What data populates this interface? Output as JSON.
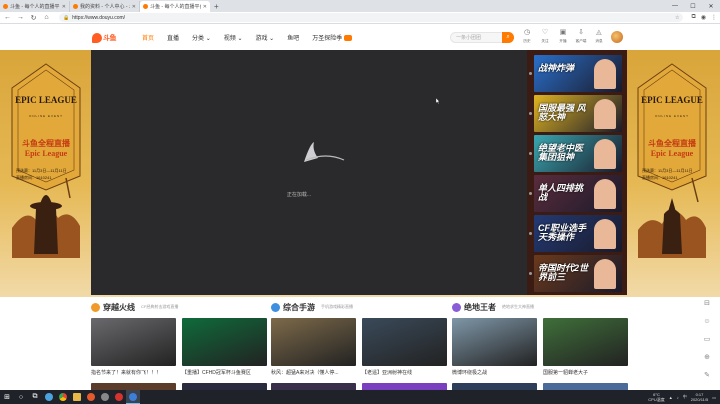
{
  "browser": {
    "tabs": [
      {
        "title": "斗鱼 - 每个人的直播平台",
        "active": false
      },
      {
        "title": "我的资料 - 个人中心 - 斗鱼",
        "active": false
      },
      {
        "title": "斗鱼 - 每个人的直播平台",
        "active": true
      }
    ],
    "new_tab": "+",
    "window_controls": [
      "—",
      "☐",
      "✕"
    ],
    "url": "https://www.douyu.com/",
    "back": "←",
    "forward": "→",
    "reload": "↻",
    "home": "⌂"
  },
  "header": {
    "logo_text": "斗鱼",
    "nav": [
      "首页",
      "直播",
      "分类",
      "视频",
      "游戏",
      "鱼吧",
      "万圣探险季"
    ],
    "nav_active_index": 0,
    "search_placeholder": "一条小团团",
    "search_button_icon": "search-icon",
    "user_menu": [
      {
        "label": "历史",
        "icon": "clock-icon"
      },
      {
        "label": "关注",
        "icon": "heart-icon"
      },
      {
        "label": "开播",
        "icon": "camera-icon"
      },
      {
        "label": "客户端",
        "icon": "download-icon"
      },
      {
        "label": "消息",
        "icon": "bell-icon"
      }
    ],
    "accent_color": "#ff7a00"
  },
  "banner": {
    "title_line1": "EPIC LEAGUE",
    "subtitle": "ONLINE EVENT",
    "cn_title": "斗鱼全程直播",
    "en_title": "Epic League",
    "date_line": "预选赛：11月3日—11月11日",
    "room_line": "直播房间：1610241"
  },
  "player": {
    "loading_text": "正在加载..."
  },
  "promo": [
    {
      "title": "战神炸弹",
      "bg": "#2a6fc9"
    },
    {
      "title": "国服最强 风怒大神",
      "bg": "#e0b422"
    },
    {
      "title": "绝望老中医 集团狙神",
      "bg": "#3aa7b0"
    },
    {
      "title": "单人四排挑战",
      "bg": "#5a2c3c"
    },
    {
      "title": "CF职业选手 天秀操作",
      "bg": "#233a74"
    },
    {
      "title": "帝国时代2世界前三",
      "bg": "#6b3a1c"
    }
  ],
  "sections": [
    {
      "title": "穿越火线",
      "subtitle": "CF经典射击游戏直播",
      "icon_color": "#f09a2a",
      "cards": [
        {
          "caption": "指名节来了！来就有你飞！！！",
          "bg": "#6a6a6e"
        },
        {
          "caption": "【重播】CFHD冠军杯斗鱼赛区",
          "bg": "#0f6b3b"
        }
      ]
    },
    {
      "title": "综合手游",
      "subtitle": "手机游戏精彩直播",
      "icon_color": "#3d8fe0",
      "cards": [
        {
          "caption": "秋风：超猛A来对决（懂人停...",
          "bg": "#7d6a4a"
        },
        {
          "caption": "【老遥】亚洲射神在线",
          "bg": "#3a4a5a"
        }
      ]
    },
    {
      "title": "绝地王者",
      "subtitle": "绝地求生大神直播",
      "icon_color": "#8a5cd6",
      "cards": [
        {
          "caption": "微博环绕极之战",
          "bg": "#7f97a8"
        },
        {
          "caption": "国服第一貂蝉老大子",
          "bg": "#3f6f3a"
        }
      ]
    }
  ],
  "floatbar": [
    "⊟",
    "☺",
    "▭",
    "⊕",
    "✎"
  ],
  "taskbar": {
    "start_icon": "windows-icon",
    "tray_temp": "6°C",
    "tray_weather": "CPU温度",
    "tray_lang": "中",
    "time": "0:17",
    "date": "2020/11/5"
  }
}
